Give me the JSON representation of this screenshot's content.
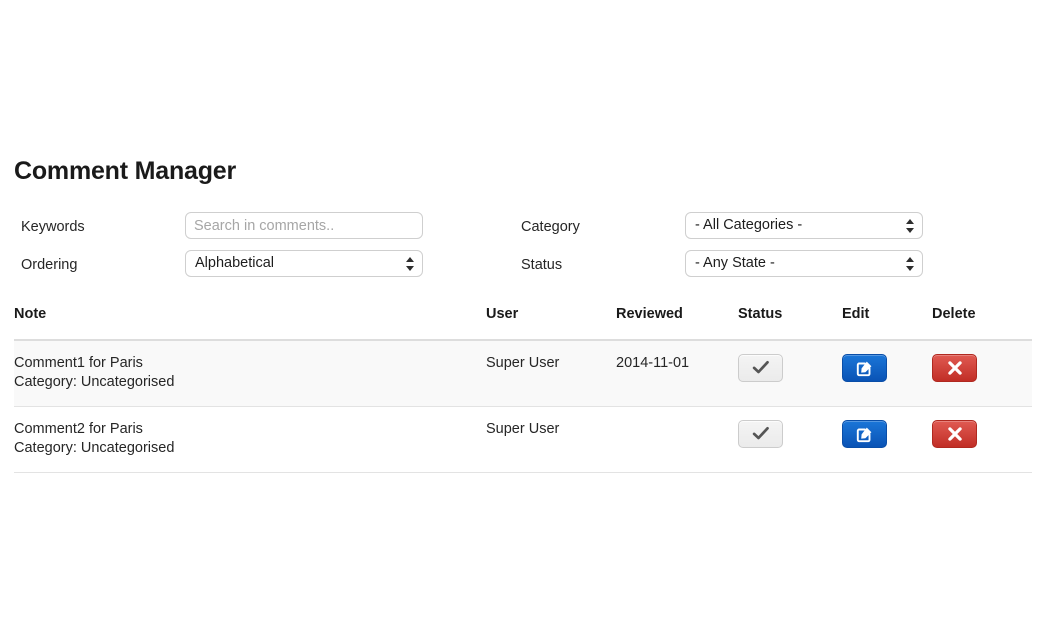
{
  "page": {
    "title": "Comment Manager"
  },
  "filters": {
    "keywords": {
      "label": "Keywords",
      "placeholder": "Search in comments..",
      "value": ""
    },
    "ordering": {
      "label": "Ordering",
      "selected": "Alphabetical"
    },
    "category": {
      "label": "Category",
      "selected": "- All Categories -"
    },
    "status": {
      "label": "Status",
      "selected": "- Any State -"
    }
  },
  "table": {
    "columns": {
      "note": "Note",
      "user": "User",
      "reviewed": "Reviewed",
      "status": "Status",
      "edit": "Edit",
      "delete": "Delete"
    },
    "rows": [
      {
        "note": "Comment1 for Paris",
        "category": "Category: Uncategorised",
        "user": "Super User",
        "reviewed": "2014-11-01",
        "status_icon": "check-icon",
        "edit_icon": "pencil-square-icon",
        "delete_icon": "cross-icon"
      },
      {
        "note": "Comment2 for Paris",
        "category": "Category: Uncategorised",
        "user": "Super User",
        "reviewed": "",
        "status_icon": "check-icon",
        "edit_icon": "pencil-square-icon",
        "delete_icon": "cross-icon"
      }
    ]
  },
  "colors": {
    "edit_blue": "#0a53b5",
    "delete_red": "#c12e26",
    "status_gray": "#ebebeb",
    "stripe": "#f9f9f9"
  }
}
